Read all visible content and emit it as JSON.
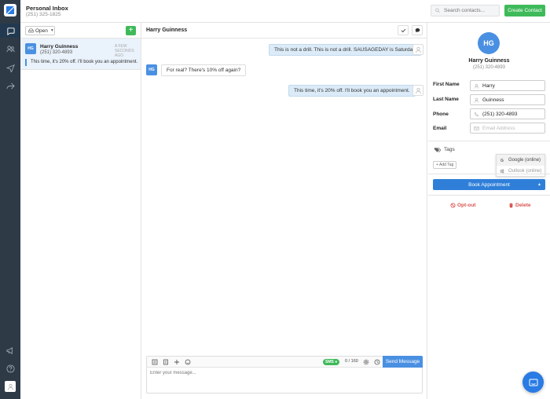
{
  "header": {
    "inbox_title": "Personal Inbox",
    "inbox_phone": "(251) 325-1825",
    "search_placeholder": "Search contacts...",
    "create_contact_label": "Create Contact"
  },
  "sidebar": {
    "items": [
      {
        "icon": "chat-bubble-icon",
        "active": true
      },
      {
        "icon": "contacts-icon",
        "active": false
      },
      {
        "icon": "send-icon",
        "active": false
      },
      {
        "icon": "forward-icon",
        "active": false
      }
    ],
    "bottom": [
      {
        "icon": "megaphone-icon"
      },
      {
        "icon": "help-icon"
      },
      {
        "icon": "user-avatar-icon"
      }
    ]
  },
  "conversations": {
    "filter_label": "Open",
    "items": [
      {
        "initials": "HG",
        "name": "Harry Guinness",
        "phone": "(251) 320-4893",
        "time": "A FEW SECONDS AGO",
        "snippet": "This time, it's 20% off. I'll book you an appointment."
      }
    ]
  },
  "chat": {
    "title": "Harry Guinness",
    "messages": [
      {
        "direction": "out",
        "text": "This is not a drill. This is not a drill. SAUSAGEDAY is Saturday"
      },
      {
        "direction": "in",
        "initials": "HG",
        "text": "For real? There's 10% off again?"
      },
      {
        "direction": "out",
        "text": "This time, it's 20% off. I'll book you an appointment."
      }
    ],
    "composer": {
      "channel_badge": "SMS",
      "char_count": "0 / 160",
      "send_label": "Send Message",
      "placeholder": "Enter your message..."
    }
  },
  "contact": {
    "initials": "HG",
    "name": "Harry Guinness",
    "phone": "(251) 320-4893",
    "fields": {
      "first_name_label": "First Name",
      "first_name_value": "Harry",
      "last_name_label": "Last Name",
      "last_name_value": "Guinness",
      "phone_label": "Phone",
      "phone_value": "(251) 320-4893",
      "email_label": "Email",
      "email_placeholder": "Email Address"
    },
    "tags_label": "Tags",
    "add_tag_label": "+ Add Tag",
    "calendar_options": [
      "Google (online)",
      "Outlook (online)"
    ],
    "book_label": "Book Appointment",
    "optout_label": "Opt-out",
    "delete_label": "Delete"
  },
  "colors": {
    "rail": "#2f3a47",
    "accent_blue": "#4a90e2",
    "accent_green": "#3fba5a",
    "danger": "#d9534f"
  }
}
